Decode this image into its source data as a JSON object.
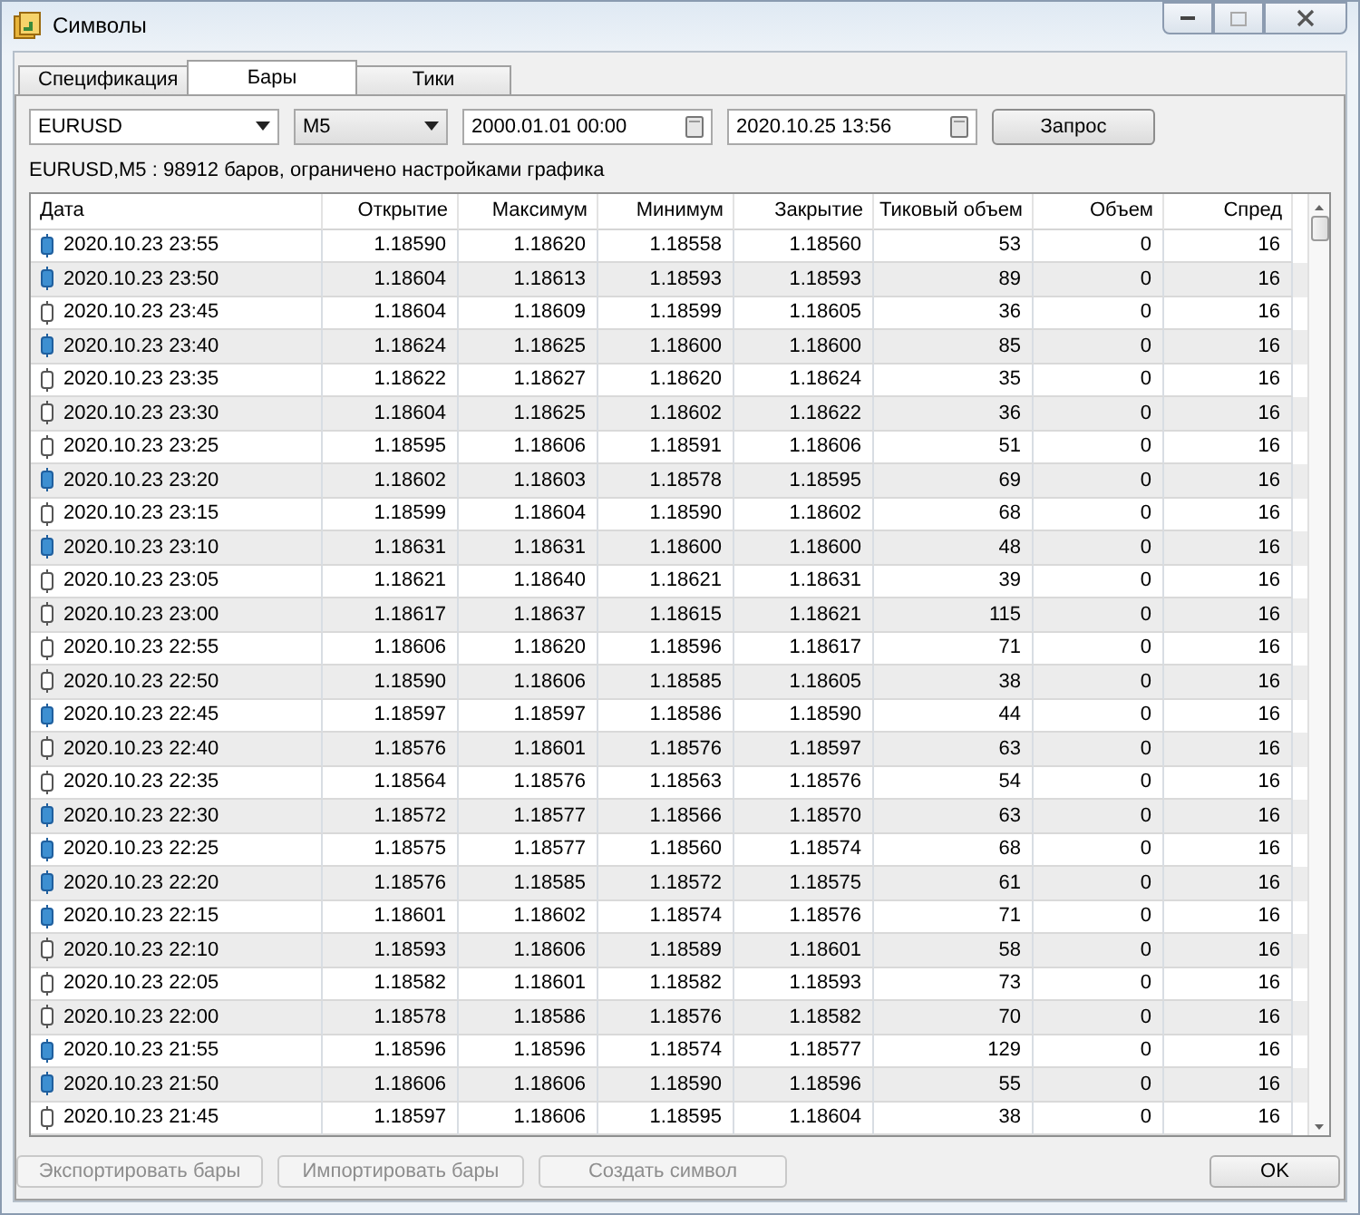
{
  "window": {
    "title": "Символы"
  },
  "tabs": [
    {
      "label": "Спецификация",
      "selected": false
    },
    {
      "label": "Бары",
      "selected": true
    },
    {
      "label": "Тики",
      "selected": false
    }
  ],
  "symbol_select": {
    "value": "EURUSD"
  },
  "timeframe_select": {
    "value": "M5"
  },
  "date_from": {
    "value": "2000.01.01 00:00"
  },
  "date_to": {
    "value": "2020.10.25 13:56"
  },
  "request_button": {
    "label": "Запрос"
  },
  "info": "EURUSD,M5 : 98912 баров, ограничено настройками графика",
  "table": {
    "columns": [
      "Дата",
      "Открытие",
      "Максимум",
      "Минимум",
      "Закрытие",
      "Тиковый объем",
      "Объем",
      "Спред"
    ],
    "rows": [
      {
        "kind": "filled",
        "cells": [
          "2020.10.23 23:55",
          "1.18590",
          "1.18620",
          "1.18558",
          "1.18560",
          "53",
          "0",
          "16"
        ]
      },
      {
        "kind": "filled",
        "cells": [
          "2020.10.23 23:50",
          "1.18604",
          "1.18613",
          "1.18593",
          "1.18593",
          "89",
          "0",
          "16"
        ]
      },
      {
        "kind": "hollow",
        "cells": [
          "2020.10.23 23:45",
          "1.18604",
          "1.18609",
          "1.18599",
          "1.18605",
          "36",
          "0",
          "16"
        ]
      },
      {
        "kind": "filled",
        "cells": [
          "2020.10.23 23:40",
          "1.18624",
          "1.18625",
          "1.18600",
          "1.18600",
          "85",
          "0",
          "16"
        ]
      },
      {
        "kind": "hollow",
        "cells": [
          "2020.10.23 23:35",
          "1.18622",
          "1.18627",
          "1.18620",
          "1.18624",
          "35",
          "0",
          "16"
        ]
      },
      {
        "kind": "hollow",
        "cells": [
          "2020.10.23 23:30",
          "1.18604",
          "1.18625",
          "1.18602",
          "1.18622",
          "36",
          "0",
          "16"
        ]
      },
      {
        "kind": "hollow",
        "cells": [
          "2020.10.23 23:25",
          "1.18595",
          "1.18606",
          "1.18591",
          "1.18606",
          "51",
          "0",
          "16"
        ]
      },
      {
        "kind": "filled",
        "cells": [
          "2020.10.23 23:20",
          "1.18602",
          "1.18603",
          "1.18578",
          "1.18595",
          "69",
          "0",
          "16"
        ]
      },
      {
        "kind": "hollow",
        "cells": [
          "2020.10.23 23:15",
          "1.18599",
          "1.18604",
          "1.18590",
          "1.18602",
          "68",
          "0",
          "16"
        ]
      },
      {
        "kind": "filled",
        "cells": [
          "2020.10.23 23:10",
          "1.18631",
          "1.18631",
          "1.18600",
          "1.18600",
          "48",
          "0",
          "16"
        ]
      },
      {
        "kind": "hollow",
        "cells": [
          "2020.10.23 23:05",
          "1.18621",
          "1.18640",
          "1.18621",
          "1.18631",
          "39",
          "0",
          "16"
        ]
      },
      {
        "kind": "hollow",
        "cells": [
          "2020.10.23 23:00",
          "1.18617",
          "1.18637",
          "1.18615",
          "1.18621",
          "115",
          "0",
          "16"
        ]
      },
      {
        "kind": "hollow",
        "cells": [
          "2020.10.23 22:55",
          "1.18606",
          "1.18620",
          "1.18596",
          "1.18617",
          "71",
          "0",
          "16"
        ]
      },
      {
        "kind": "hollow",
        "cells": [
          "2020.10.23 22:50",
          "1.18590",
          "1.18606",
          "1.18585",
          "1.18605",
          "38",
          "0",
          "16"
        ]
      },
      {
        "kind": "filled",
        "cells": [
          "2020.10.23 22:45",
          "1.18597",
          "1.18597",
          "1.18586",
          "1.18590",
          "44",
          "0",
          "16"
        ]
      },
      {
        "kind": "hollow",
        "cells": [
          "2020.10.23 22:40",
          "1.18576",
          "1.18601",
          "1.18576",
          "1.18597",
          "63",
          "0",
          "16"
        ]
      },
      {
        "kind": "hollow",
        "cells": [
          "2020.10.23 22:35",
          "1.18564",
          "1.18576",
          "1.18563",
          "1.18576",
          "54",
          "0",
          "16"
        ]
      },
      {
        "kind": "filled",
        "cells": [
          "2020.10.23 22:30",
          "1.18572",
          "1.18577",
          "1.18566",
          "1.18570",
          "63",
          "0",
          "16"
        ]
      },
      {
        "kind": "filled",
        "cells": [
          "2020.10.23 22:25",
          "1.18575",
          "1.18577",
          "1.18560",
          "1.18574",
          "68",
          "0",
          "16"
        ]
      },
      {
        "kind": "filled",
        "cells": [
          "2020.10.23 22:20",
          "1.18576",
          "1.18585",
          "1.18572",
          "1.18575",
          "61",
          "0",
          "16"
        ]
      },
      {
        "kind": "filled",
        "cells": [
          "2020.10.23 22:15",
          "1.18601",
          "1.18602",
          "1.18574",
          "1.18576",
          "71",
          "0",
          "16"
        ]
      },
      {
        "kind": "hollow",
        "cells": [
          "2020.10.23 22:10",
          "1.18593",
          "1.18606",
          "1.18589",
          "1.18601",
          "58",
          "0",
          "16"
        ]
      },
      {
        "kind": "hollow",
        "cells": [
          "2020.10.23 22:05",
          "1.18582",
          "1.18601",
          "1.18582",
          "1.18593",
          "73",
          "0",
          "16"
        ]
      },
      {
        "kind": "hollow",
        "cells": [
          "2020.10.23 22:00",
          "1.18578",
          "1.18586",
          "1.18576",
          "1.18582",
          "70",
          "0",
          "16"
        ]
      },
      {
        "kind": "filled",
        "cells": [
          "2020.10.23 21:55",
          "1.18596",
          "1.18596",
          "1.18574",
          "1.18577",
          "129",
          "0",
          "16"
        ]
      },
      {
        "kind": "filled",
        "cells": [
          "2020.10.23 21:50",
          "1.18606",
          "1.18606",
          "1.18590",
          "1.18596",
          "55",
          "0",
          "16"
        ]
      },
      {
        "kind": "hollow",
        "cells": [
          "2020.10.23 21:45",
          "1.18597",
          "1.18606",
          "1.18595",
          "1.18604",
          "38",
          "0",
          "16"
        ]
      }
    ]
  },
  "buttons": [
    {
      "label": "Экспортировать бары",
      "disabled": true
    },
    {
      "label": "Импортировать бары",
      "disabled": true
    },
    {
      "label": "Создать символ",
      "disabled": true
    },
    {
      "label": "OK",
      "disabled": false
    }
  ]
}
